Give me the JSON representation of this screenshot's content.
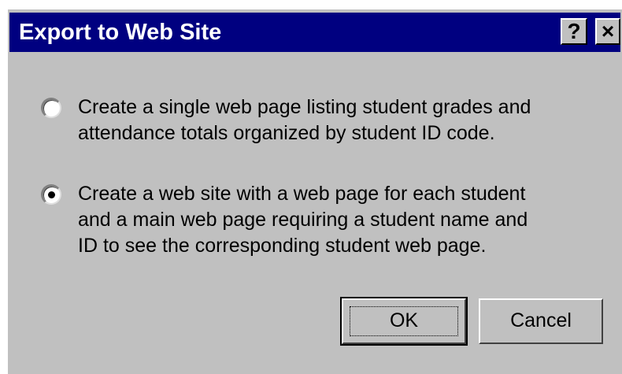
{
  "dialog": {
    "title": "Export to Web Site",
    "help_label": "?",
    "close_label": "×"
  },
  "options": [
    {
      "text": "Create a single web page listing student grades and\nattendance totals organized by student ID code.",
      "selected": false
    },
    {
      "text": "Create a web site with a web page for each student\nand a main web page requiring a student name and\nID to see the corresponding student web page.",
      "selected": true
    }
  ],
  "buttons": {
    "ok_label": "OK",
    "cancel_label": "Cancel"
  },
  "colors": {
    "titlebar": "#000080",
    "face": "#c0c0c0"
  }
}
